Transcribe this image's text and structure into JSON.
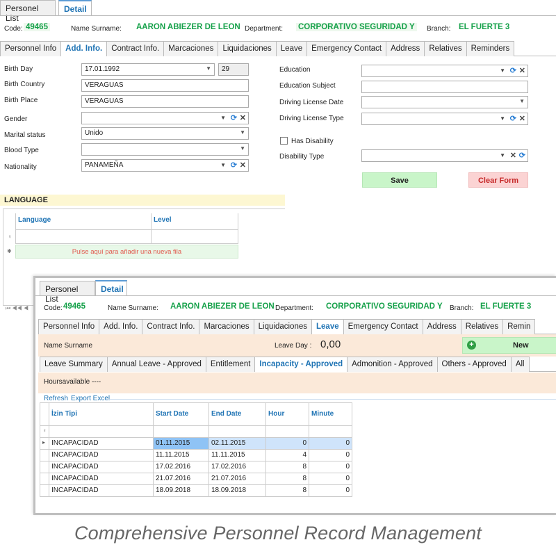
{
  "main_tabs": [
    "Personel List",
    "Detail"
  ],
  "header": {
    "code_label": "Code:",
    "code_value": "49465",
    "name_label": "Name Surname:",
    "name_value": "AARON ABIEZER DE LEON",
    "dept_label": "Department:",
    "dept_value": "CORPORATIVO SEGURIDAD Y",
    "branch_label": "Branch:",
    "branch_value": "EL FUERTE 3"
  },
  "sub_tabs_back": [
    "Personnel Info",
    "Add. Info.",
    "Contract Info.",
    "Marcaciones",
    "Liquidaciones",
    "Leave",
    "Emergency Contact",
    "Address",
    "Relatives",
    "Reminders"
  ],
  "form": {
    "birth_day_label": "Birth Day",
    "birth_day_value": "17.01.1992",
    "age_value": "29",
    "birth_country_label": "Birth Country",
    "birth_country_value": "VERAGUAS",
    "birth_place_label": "Birth Place",
    "birth_place_value": "VERAGUAS",
    "gender_label": "Gender",
    "marital_label": "Marital status",
    "marital_value": "Unido",
    "blood_label": "Blood Type",
    "nationality_label": "Nationality",
    "nationality_value": "PANAMEÑA",
    "education_label": "Education",
    "education_subject_label": "Education Subject",
    "driving_date_label": "Driving License Date",
    "driving_type_label": "Driving License Type",
    "has_disability_label": "Has Disability",
    "disability_type_label": "Disability Type",
    "save_label": "Save",
    "clear_label": "Clear Form"
  },
  "language": {
    "title": "LANGUAGE",
    "col_language": "Language",
    "col_level": "Level",
    "new_row_hint": "Pulse aquí para añadir una nueva fila"
  },
  "front": {
    "main_tabs": [
      "Personel List",
      "Detail"
    ],
    "sub_tabs": [
      "Personnel Info",
      "Add. Info.",
      "Contract Info.",
      "Marcaciones",
      "Liquidaciones",
      "Leave",
      "Emergency Contact",
      "Address",
      "Relatives",
      "Remin"
    ],
    "name_surname_label": "Name Surname",
    "leave_day_label": "Leave Day :",
    "leave_day_value": "0,00",
    "new_label": "New",
    "leave_tabs": [
      "Leave Summary",
      "Annual Leave - Approved",
      "Entitlement",
      "Incapacity - Approved",
      "Admonition - Approved",
      "Others - Approved",
      "All"
    ],
    "hours_label": "Hoursavailable",
    "hours_value": "----",
    "refresh_label": "Refresh",
    "export_label": "Export Excel",
    "table": {
      "columns": [
        "İzin Tipi",
        "Start Date",
        "End Date",
        "Hour",
        "Minute"
      ],
      "rows": [
        [
          "INCAPACIDAD",
          "01.11.2015",
          "02.11.2015",
          "0",
          "0"
        ],
        [
          "INCAPACIDAD",
          "11.11.2015",
          "11.11.2015",
          "4",
          "0"
        ],
        [
          "INCAPACIDAD",
          "17.02.2016",
          "17.02.2016",
          "8",
          "0"
        ],
        [
          "INCAPACIDAD",
          "21.07.2016",
          "21.07.2016",
          "8",
          "0"
        ],
        [
          "INCAPACIDAD",
          "18.09.2018",
          "18.09.2018",
          "8",
          "0"
        ]
      ]
    }
  },
  "caption": "Comprehensive Personnel Record Management",
  "colors": {
    "accent": "#1e73b4",
    "green": "#16a14a",
    "save_bg": "#c9f5c9",
    "clear_bg": "#fbd3d3",
    "panel_bg": "#fbe9d9"
  }
}
